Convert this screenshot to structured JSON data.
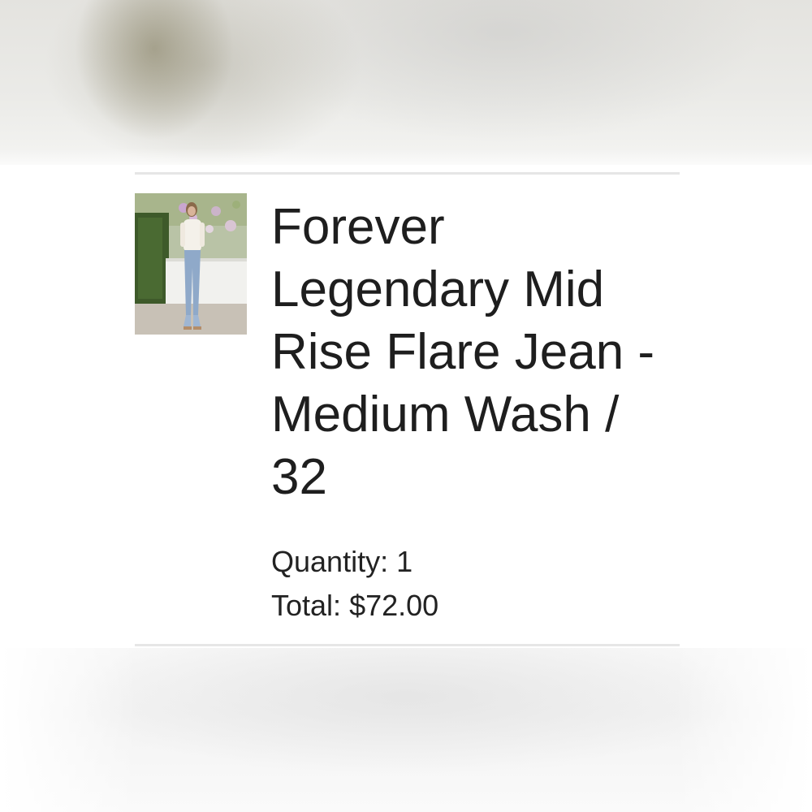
{
  "cart_item": {
    "product_title": "Forever Legendary Mid Rise Flare Jean - Medium Wash / 32",
    "image_alt": "Model wearing flare jeans outdoors",
    "quantity_label": "Quantity:",
    "quantity_value": "1",
    "total_label": "Total:",
    "total_value": "$72.00"
  },
  "colors": {
    "text": "#1e1e1e",
    "divider": "#e6e6e6",
    "background": "#ffffff"
  }
}
